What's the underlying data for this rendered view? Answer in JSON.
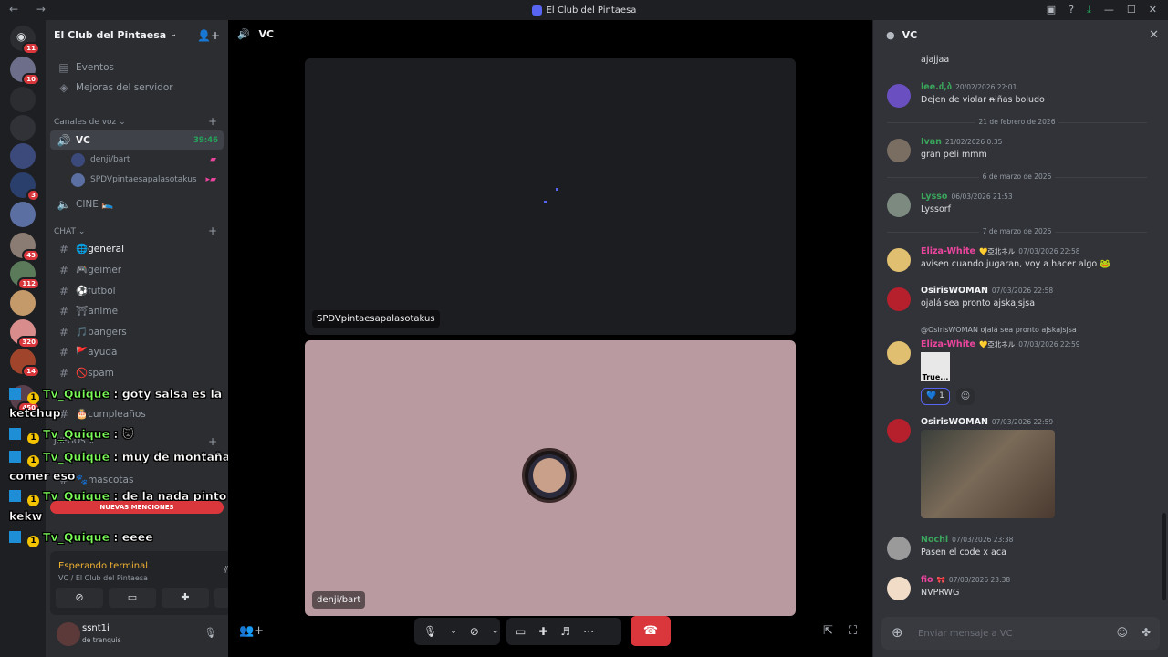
{
  "window": {
    "title": "El Club del Pintaesa"
  },
  "servers": {
    "home_badge": "11",
    "items": [
      {
        "badge": "10",
        "color": "#6d6f8a"
      },
      {
        "badge": "",
        "color": "#2b2d31"
      },
      {
        "badge": "",
        "color": "#303238"
      },
      {
        "badge": "",
        "color": "#3b4a7a"
      },
      {
        "badge": "3",
        "color": "#2a3f6b"
      },
      {
        "badge": "",
        "color": "#5c6fa3"
      },
      {
        "badge": "43",
        "color": "#8a7c72"
      },
      {
        "badge": "112",
        "color": "#5a7a5a"
      },
      {
        "badge": "",
        "color": "#c59a6a"
      },
      {
        "badge": "320",
        "color": "#d98c8c"
      },
      {
        "badge": "14",
        "color": "#a0452b"
      },
      {
        "badge": "450",
        "color": "#5a3f4d"
      }
    ]
  },
  "sidebar": {
    "server_name": "El Club del Pintaesa",
    "events": "Eventos",
    "boost": "Mejoras del servidor",
    "voice_category": "Canales de voz",
    "vc": {
      "name": "VC",
      "timer": "39:46"
    },
    "vc_users": [
      "denji/bart",
      "SPDVpintaesapalasotakus"
    ],
    "cine": "CINE 🛌",
    "chat_category": "CHAT",
    "channels": [
      "🌐general",
      "🎮geimer",
      "⚽futbol",
      "⛩anime",
      "🎵bangers",
      "🚩ayuda",
      "🚫spam",
      "🎂cumpleaños",
      "🐾mascotas"
    ],
    "juegos_category": "JUEGOS"
  },
  "overlay": {
    "lines": [
      {
        "user": "Tv_Quique",
        "text": ": goty salsa es la"
      },
      {
        "user": "",
        "text": "ketchup"
      },
      {
        "user": "Tv_Quique",
        "text": ": 🐱"
      },
      {
        "user": "Tv_Quique",
        "text": ": muy de montaña"
      },
      {
        "user": "",
        "text": "comer eso"
      },
      {
        "user": "Tv_Quique",
        "text": ": de la nada pinto charla"
      },
      {
        "user": "",
        "text": "kekw"
      },
      {
        "user": "Tv_Quique",
        "text": ": eeee"
      }
    ],
    "badge_num": "1"
  },
  "new_mentions": "NUEVAS MENCIONES",
  "voice_panel": {
    "status": "Esperando terminal",
    "sub": "VC / El Club del Pintaesa"
  },
  "user": {
    "name": "ssnt1i",
    "status": "de tranquis"
  },
  "stage": {
    "title": "VC",
    "tiles": [
      {
        "label": "SPDVpintaesapalasotakus"
      },
      {
        "label": "denji/bart"
      }
    ]
  },
  "chat": {
    "title": "VC",
    "messages": [
      {
        "body": "ajajjaa"
      },
      {
        "author": "lee.ძ,ბ",
        "color": "#3ba55c",
        "time": "20/02/2026 22:01",
        "body": "Dejen de violar n̶iñas boludo",
        "avatar": "#6a4fc1"
      },
      {
        "divider": "21 de febrero de 2026"
      },
      {
        "author": "Ivan",
        "color": "#3ba55c",
        "time": "21/02/2026 0:35",
        "body": "gran peli mmm",
        "avatar": "#7a6e62"
      },
      {
        "divider": "6 de marzo de 2026"
      },
      {
        "author": "Lysso",
        "color": "#3ba55c",
        "time": "06/03/2026 21:53",
        "body": "Lyssorf",
        "avatar": "#7c8a80"
      },
      {
        "divider": "7 de marzo de 2026"
      },
      {
        "author": "Eliza-White",
        "color": "#eb459e",
        "tag": "💛亞北ネル",
        "time": "07/03/2026 22:58",
        "body": "avisen cuando jugaran, voy a hacer algo 🐸",
        "avatar": "#e0c070"
      },
      {
        "author": "OsirisWOMAN",
        "color": "#f2f3f5",
        "time": "07/03/2026 22:58",
        "body": "ojalá sea pronto ajskajsjsa",
        "avatar": "#b5202c"
      },
      {
        "reply": "@OsirisWOMAN ojalá sea pronto ajskajsjsa",
        "author": "Eliza-White",
        "color": "#eb459e",
        "tag": "💛亞北ネル",
        "time": "07/03/2026 22:59",
        "attach": "True...",
        "reaction": "💙 1",
        "avatar": "#e0c070"
      },
      {
        "author": "OsirisWOMAN",
        "color": "#f2f3f5",
        "time": "07/03/2026 22:59",
        "avatar": "#b5202c"
      },
      {
        "author": "Nochi",
        "color": "#3ba55c",
        "time": "07/03/2026 23:38",
        "body": "Pasen el code x aca",
        "avatar": "#9a9a9a"
      },
      {
        "author": "fio",
        "color": "#eb459e",
        "tag": "🎀",
        "time": "07/03/2026 23:38",
        "body": "NVPRWG",
        "avatar": "#f1dcc8"
      }
    ],
    "input_placeholder": "Enviar mensaje a VC"
  }
}
